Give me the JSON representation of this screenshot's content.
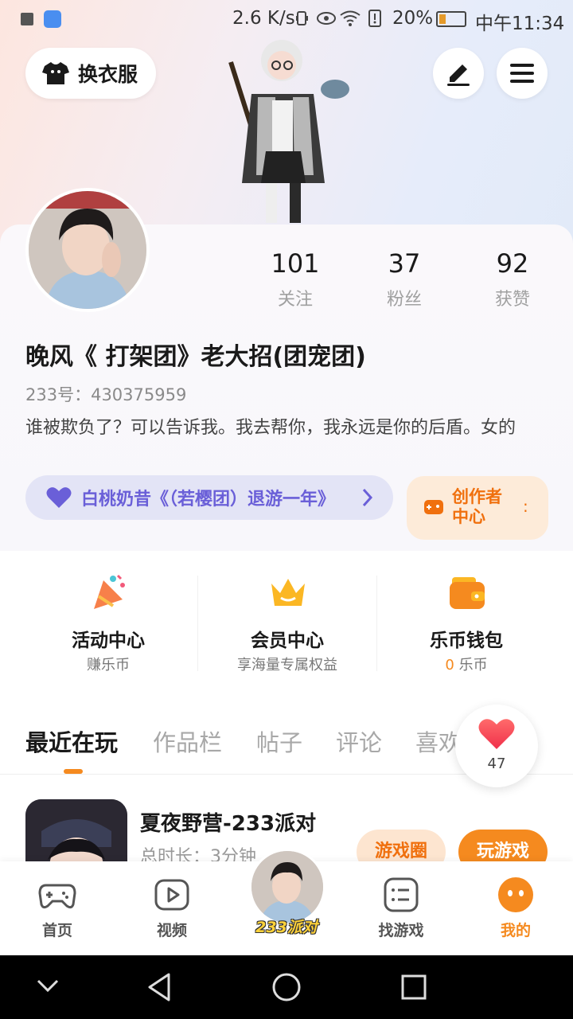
{
  "status_bar": {
    "speed": "2.6 K/s",
    "battery": "20%",
    "time": "中午11:34"
  },
  "header": {
    "outfit_label": "换衣服",
    "edit_icon": "pen-icon",
    "menu_icon": "hamburger-icon"
  },
  "profile": {
    "stats": [
      {
        "value": "101",
        "label": "关注"
      },
      {
        "value": "37",
        "label": "粉丝"
      },
      {
        "value": "92",
        "label": "获赞"
      }
    ],
    "nickname": "晚风《 打架团》老大招(团宠团)",
    "uid": "233号：430375959",
    "bio": "谁被欺负了？可以告诉我。我去帮你，我永远是你的后盾。女的",
    "group_label": "白桃奶昔《（若樱团）退游一年》",
    "creator_label": "创作者中心",
    "creator_more": ":"
  },
  "services": [
    {
      "title": "活动中心",
      "sub": "赚乐币",
      "icon": "party-popper-icon"
    },
    {
      "title": "会员中心",
      "sub": "享海量专属权益",
      "icon": "crown-icon"
    },
    {
      "title": "乐币钱包",
      "sub_value": "0",
      "sub_unit": "乐币",
      "icon": "wallet-icon"
    }
  ],
  "tabs": [
    "最近在玩",
    "作品栏",
    "帖子",
    "评论",
    "喜欢"
  ],
  "likes": {
    "count": "47"
  },
  "recent_game": {
    "title": "夏夜野营-233派对",
    "time": "总时长：3分钟",
    "circle_label": "游戏圈",
    "play_label": "玩游戏"
  },
  "bottom_nav": {
    "items": [
      {
        "label": "首页",
        "icon": "gamepad-icon"
      },
      {
        "label": "视频",
        "icon": "play-icon"
      },
      {
        "label": "找游戏",
        "icon": "list-icon"
      },
      {
        "label": "我的",
        "icon": "me-icon"
      }
    ],
    "center_label": "233派对"
  },
  "colors": {
    "accent": "#f58a1f",
    "group_text": "#6a5fd8",
    "creator_text": "#f0700e"
  }
}
